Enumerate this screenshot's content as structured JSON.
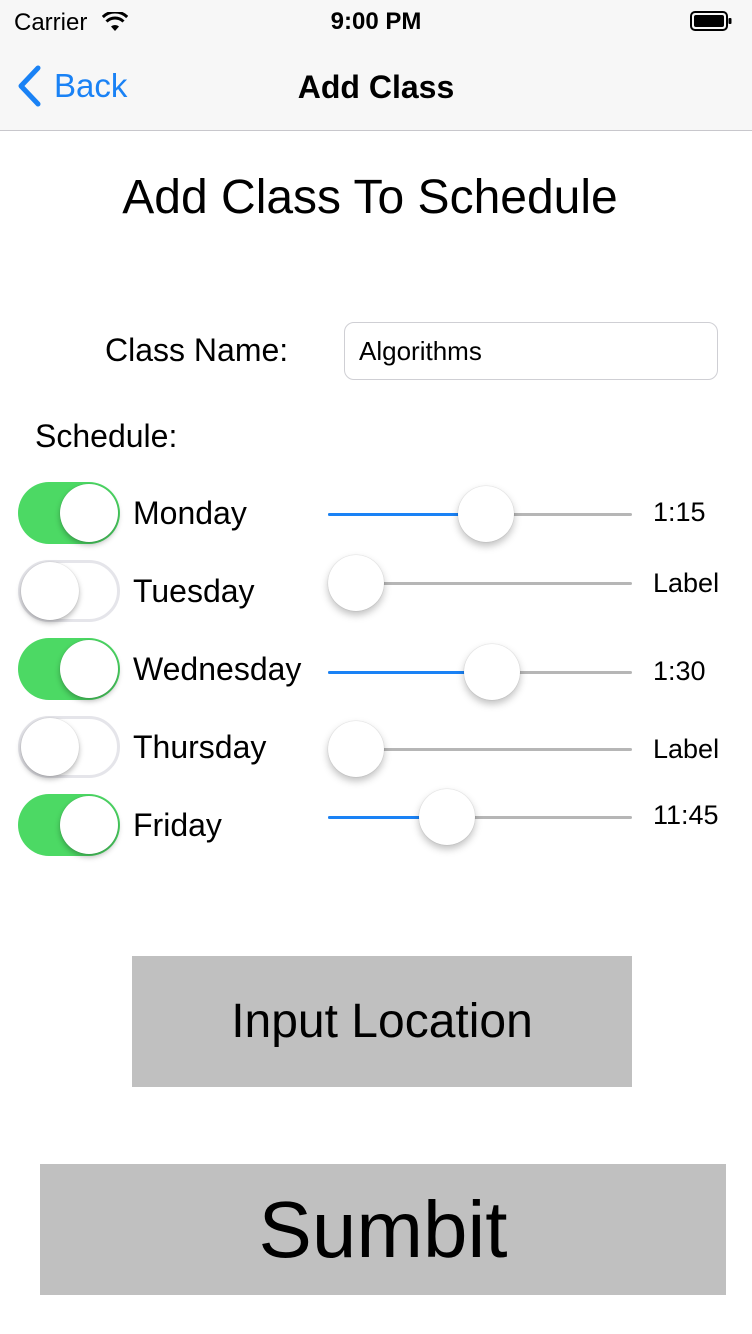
{
  "status_bar": {
    "carrier": "Carrier",
    "time": "9:00 PM"
  },
  "nav": {
    "back_label": "Back",
    "title": "Add Class"
  },
  "page": {
    "heading": "Add Class To Schedule",
    "class_name_label": "Class Name:",
    "class_name_value": "Algorithms",
    "schedule_label": "Schedule:"
  },
  "schedule": [
    {
      "day": "Monday",
      "enabled": true,
      "slider_value": 0.52,
      "time_label": "1:15"
    },
    {
      "day": "Tuesday",
      "enabled": false,
      "slider_value": 0.0,
      "time_label": "Label"
    },
    {
      "day": "Wednesday",
      "enabled": true,
      "slider_value": 0.54,
      "time_label": "1:30"
    },
    {
      "day": "Thursday",
      "enabled": false,
      "slider_value": 0.0,
      "time_label": "Label"
    },
    {
      "day": "Friday",
      "enabled": true,
      "slider_value": 0.39,
      "time_label": "11:45"
    }
  ],
  "buttons": {
    "input_location": "Input Location",
    "submit": "Sumbit"
  },
  "colors": {
    "accent": "#1a82f5",
    "switch_on": "#4cd964",
    "button_bg": "#c0c0c0"
  }
}
